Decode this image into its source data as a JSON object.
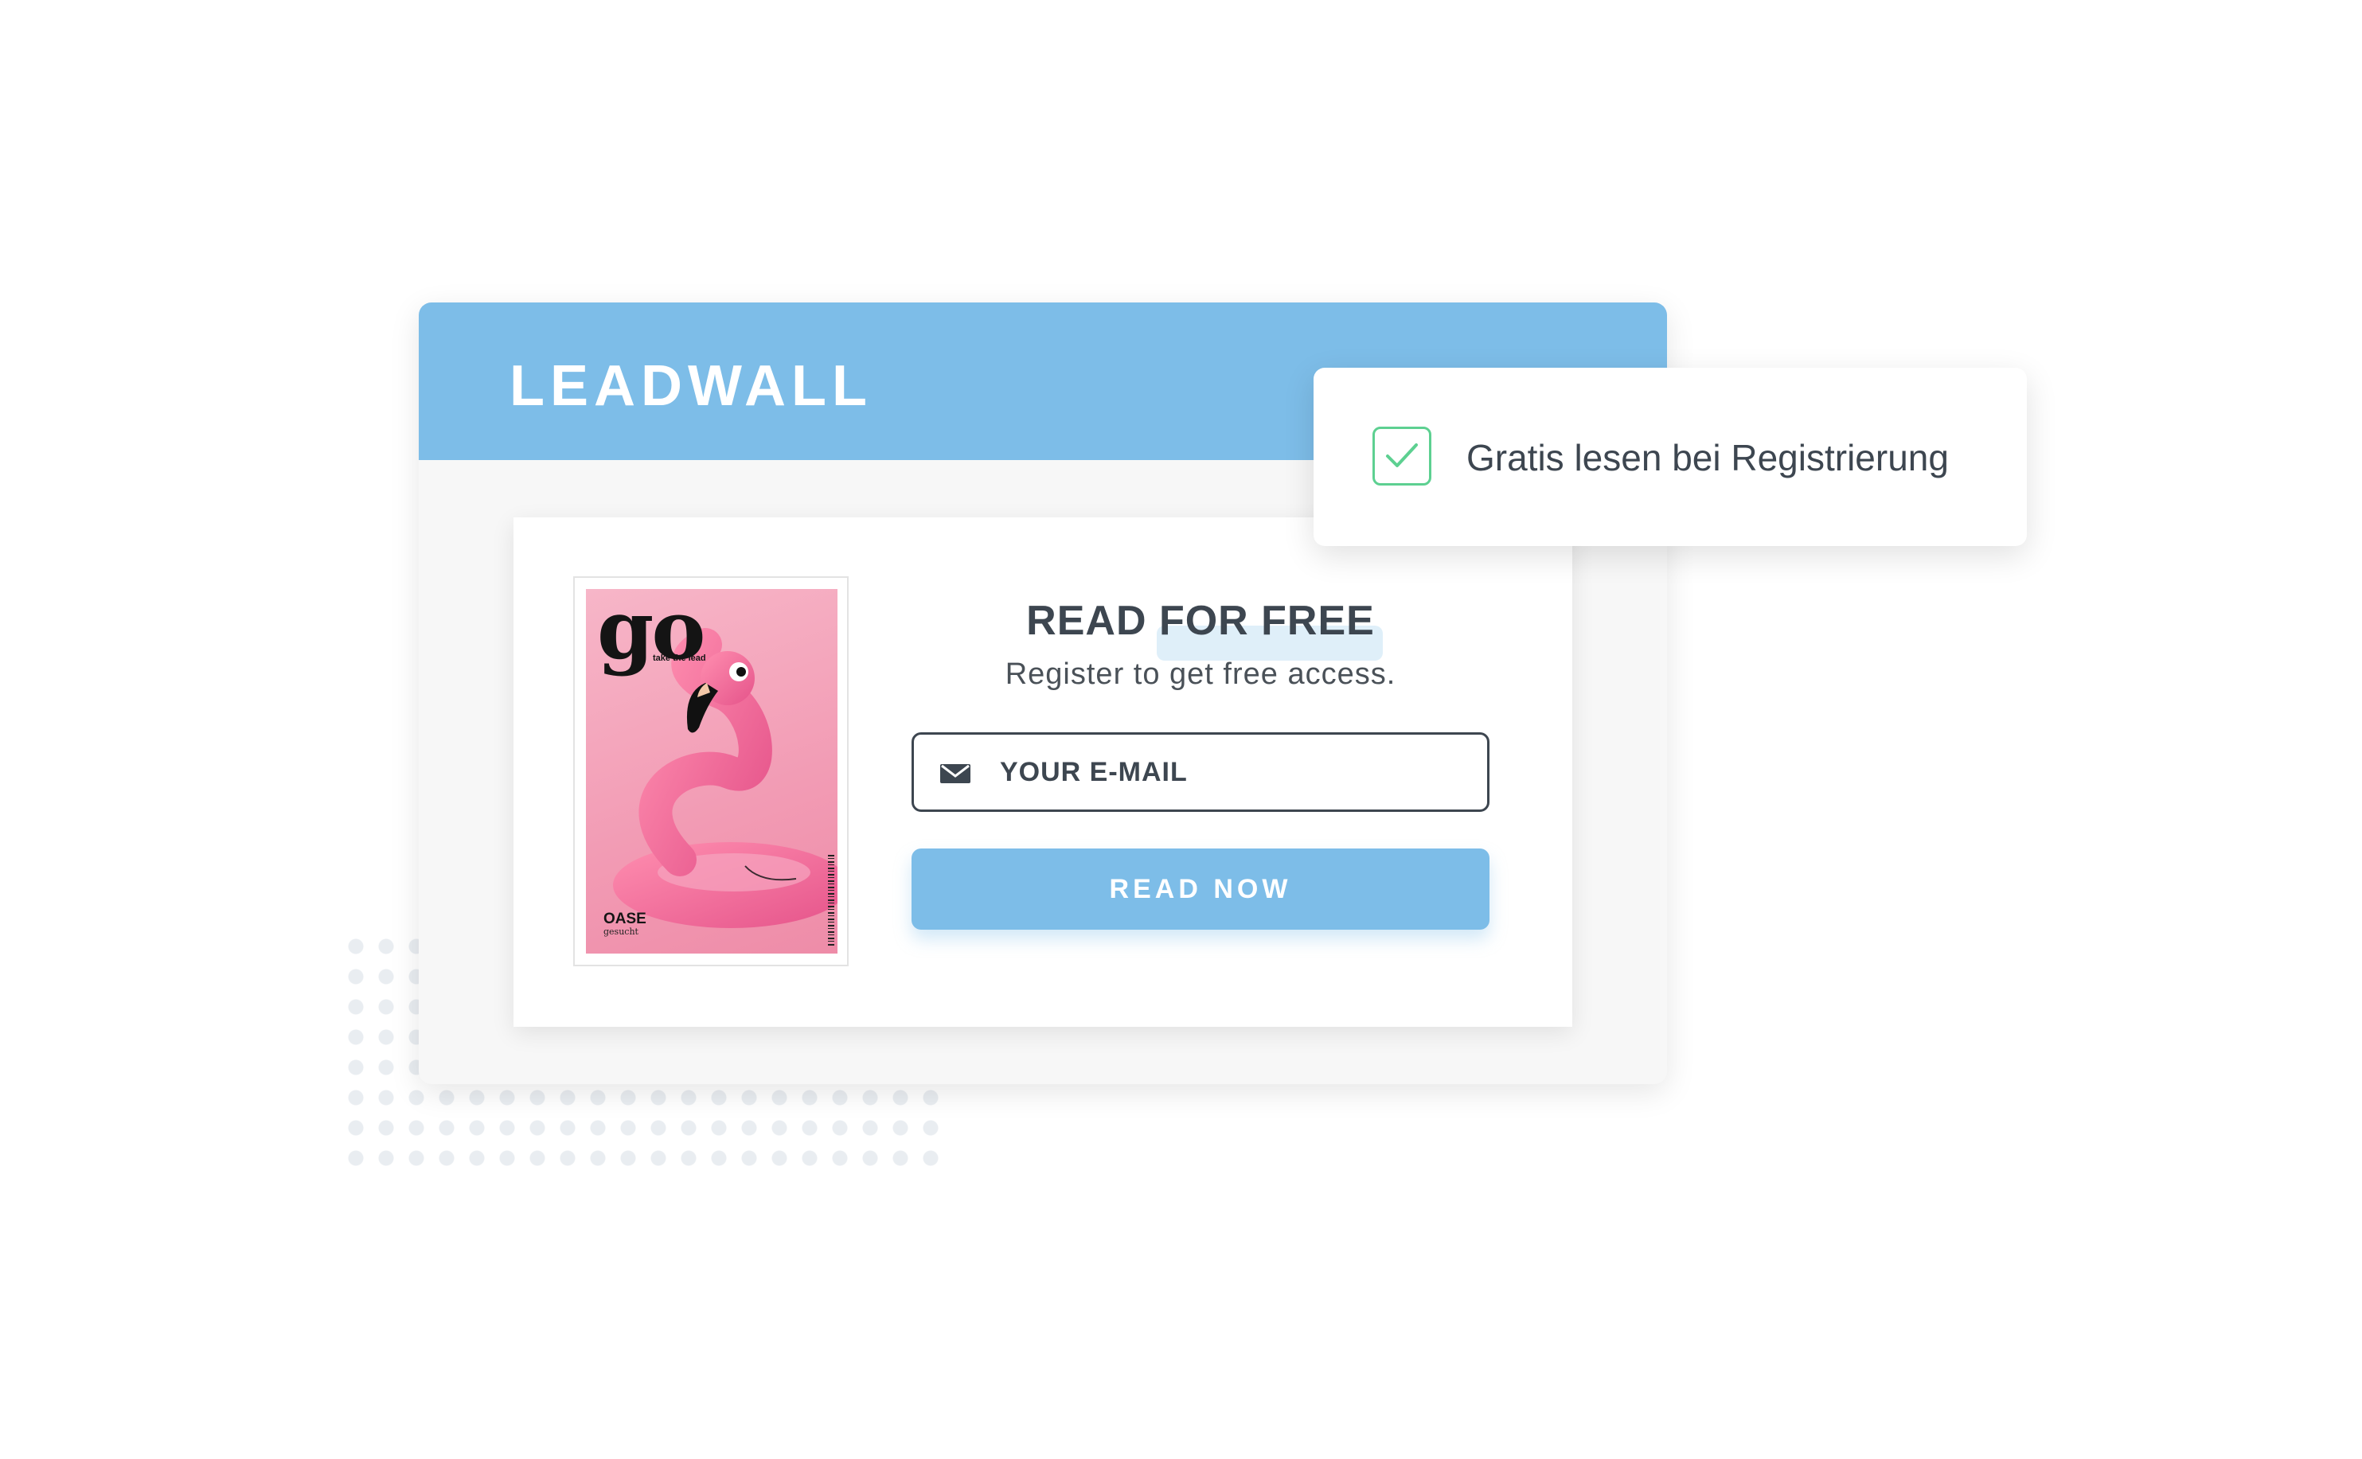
{
  "header": {
    "brand": "LEADWALL"
  },
  "magazine": {
    "logo": "go",
    "tagline": "take the lead",
    "cover_title": "OASE",
    "cover_subtitle": "gesucht"
  },
  "form": {
    "heading": "READ FOR FREE",
    "subheading": "Register to get free access.",
    "email_placeholder": "YOUR E-MAIL",
    "email_value": "",
    "submit_label": "READ NOW"
  },
  "notification": {
    "text": "Gratis lesen bei Registrierung",
    "checked": true
  },
  "colors": {
    "accent": "#7dbde8",
    "text_dark": "#3d4650",
    "check_green": "#5dd091",
    "cover_pink": "#f29bb4"
  },
  "icons": {
    "mail": "envelope-icon",
    "check": "checkmark-icon"
  }
}
